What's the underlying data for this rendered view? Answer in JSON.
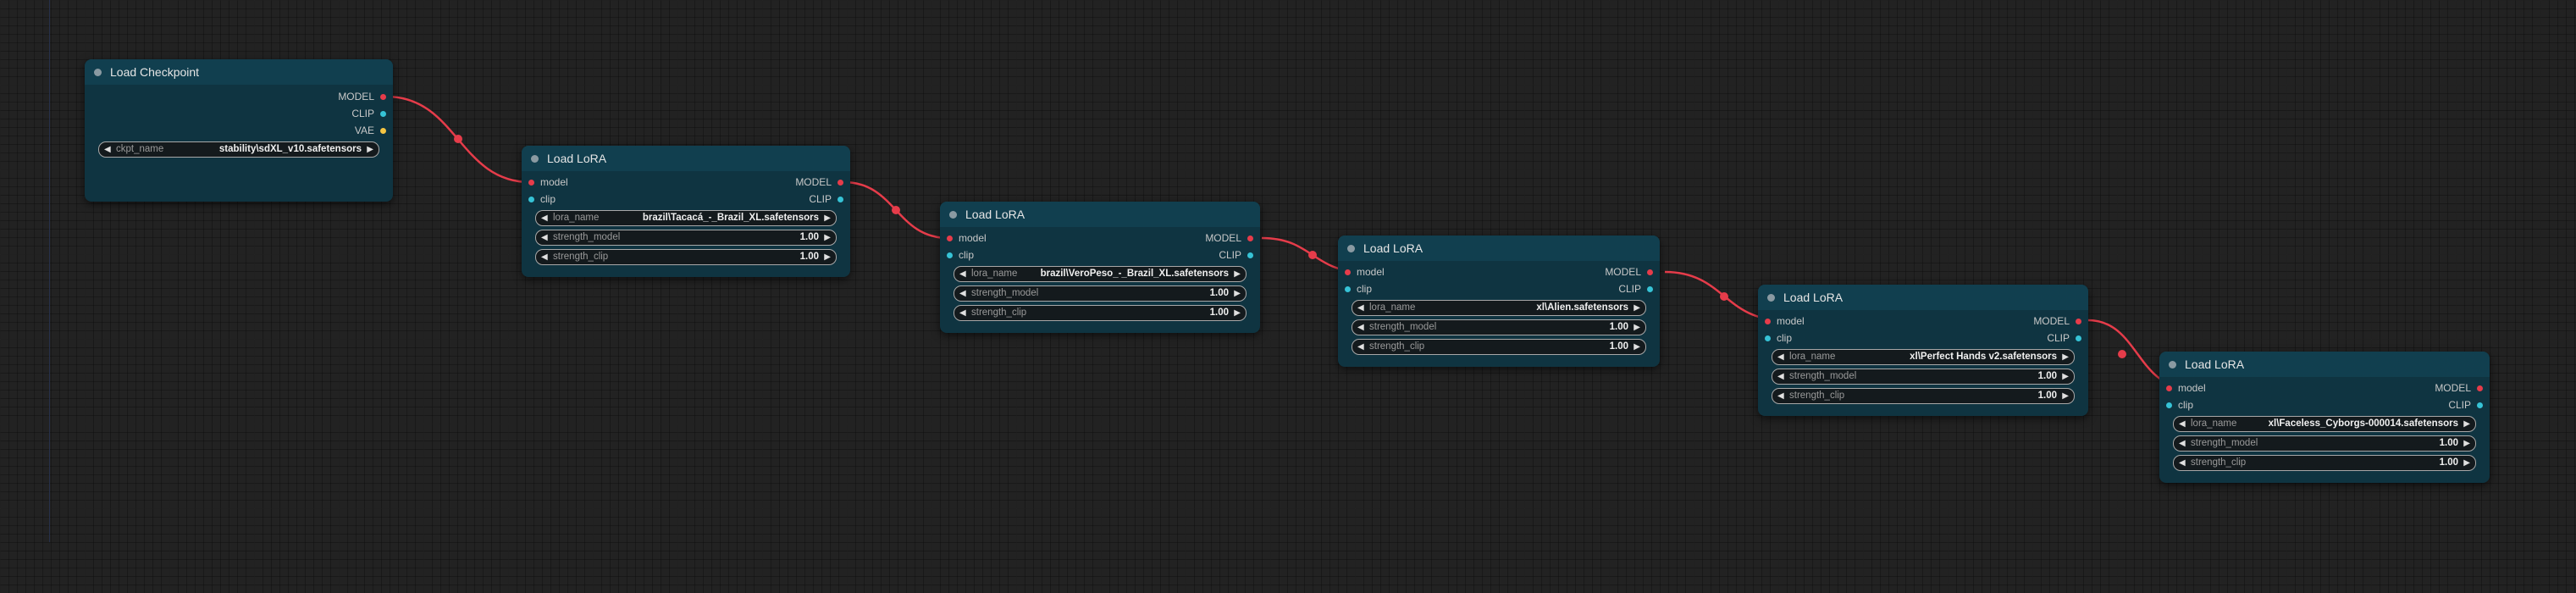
{
  "colors": {
    "canvas_bg": "#222222",
    "node_bg": "#0f3441",
    "node_title_bg": "#113f4f",
    "model_link": "#e63c4a",
    "clip_slot": "#36c3d6",
    "vae_slot": "#f5c542"
  },
  "checkpoint": {
    "title": "Load Checkpoint",
    "outputs": {
      "model": "MODEL",
      "clip": "CLIP",
      "vae": "VAE"
    },
    "widget": {
      "name": "ckpt_name",
      "value": "stability\\sdXL_v10.safetensors"
    }
  },
  "lora_nodes": [
    {
      "title": "Load LoRA",
      "inputs": {
        "model": "model",
        "clip": "clip"
      },
      "outputs": {
        "model": "MODEL",
        "clip": "CLIP"
      },
      "lora_name": {
        "name": "lora_name",
        "value": "brazil\\Tacacá_-_Brazil_XL.safetensors"
      },
      "strength_model": {
        "name": "strength_model",
        "value": "1.00"
      },
      "strength_clip": {
        "name": "strength_clip",
        "value": "1.00"
      }
    },
    {
      "title": "Load LoRA",
      "inputs": {
        "model": "model",
        "clip": "clip"
      },
      "outputs": {
        "model": "MODEL",
        "clip": "CLIP"
      },
      "lora_name": {
        "name": "lora_name",
        "value": "brazil\\VeroPeso_-_Brazil_XL.safetensors"
      },
      "strength_model": {
        "name": "strength_model",
        "value": "1.00"
      },
      "strength_clip": {
        "name": "strength_clip",
        "value": "1.00"
      }
    },
    {
      "title": "Load LoRA",
      "inputs": {
        "model": "model",
        "clip": "clip"
      },
      "outputs": {
        "model": "MODEL",
        "clip": "CLIP"
      },
      "lora_name": {
        "name": "lora_name",
        "value": "xl\\Alien.safetensors"
      },
      "strength_model": {
        "name": "strength_model",
        "value": "1.00"
      },
      "strength_clip": {
        "name": "strength_clip",
        "value": "1.00"
      }
    },
    {
      "title": "Load LoRA",
      "inputs": {
        "model": "model",
        "clip": "clip"
      },
      "outputs": {
        "model": "MODEL",
        "clip": "CLIP"
      },
      "lora_name": {
        "name": "lora_name",
        "value": "xl\\Perfect Hands v2.safetensors"
      },
      "strength_model": {
        "name": "strength_model",
        "value": "1.00"
      },
      "strength_clip": {
        "name": "strength_clip",
        "value": "1.00"
      }
    },
    {
      "title": "Load LoRA",
      "inputs": {
        "model": "model",
        "clip": "clip"
      },
      "outputs": {
        "model": "MODEL",
        "clip": "CLIP"
      },
      "lora_name": {
        "name": "lora_name",
        "value": "xl\\Faceless_Cyborgs-000014.safetensors"
      },
      "strength_model": {
        "name": "strength_model",
        "value": "1.00"
      },
      "strength_clip": {
        "name": "strength_clip",
        "value": "1.00"
      }
    }
  ]
}
